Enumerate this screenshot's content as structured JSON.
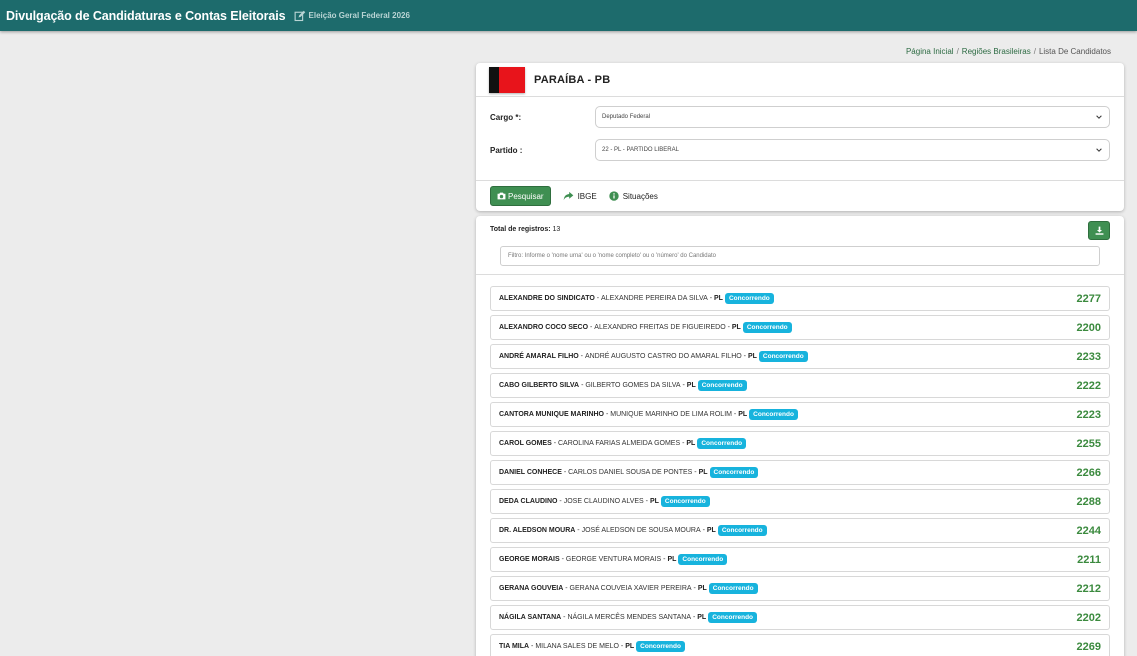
{
  "header": {
    "title": "Divulgação de Candidaturas e Contas Eleitorais",
    "election": "Eleição Geral Federal 2026"
  },
  "breadcrumb": {
    "home": "Página Inicial",
    "regions": "Regiões Brasileiras",
    "current": "Lista De Candidatos"
  },
  "state": {
    "name": "PARAÍBA - PB",
    "flag_text": "NEGO",
    "flag_colors": [
      "#111111",
      "#e8141b"
    ]
  },
  "form": {
    "cargo_label": "Cargo *:",
    "cargo_value": "Deputado Federal",
    "partido_label": "Partido :",
    "partido_value": "22 - PL - PARTIDO LIBERAL"
  },
  "actions": {
    "search": "Pesquisar",
    "ibge": "IBGE",
    "situacoes": "Situações"
  },
  "results": {
    "total_label": "Total de registros:",
    "total_value": "13",
    "filter_placeholder": "Filtro: Informe o 'nome urna' ou o 'nome completo' ou o 'número' do Candidato",
    "status_color": "#17b3dd",
    "number_color": "#3b8a3e",
    "candidates": [
      {
        "urn": "ALEXANDRE DO SINDICATO",
        "full": "ALEXANDRE PEREIRA DA SILVA",
        "party": "PL",
        "status": "Concorrendo",
        "number": "2277"
      },
      {
        "urn": "ALEXANDRO COCO SECO",
        "full": "ALEXANDRO FREITAS DE FIGUEIREDO",
        "party": "PL",
        "status": "Concorrendo",
        "number": "2200"
      },
      {
        "urn": "ANDRÉ AMARAL FILHO",
        "full": "ANDRÉ AUGUSTO CASTRO DO AMARAL FILHO",
        "party": "PL",
        "status": "Concorrendo",
        "number": "2233"
      },
      {
        "urn": "CABO GILBERTO SILVA",
        "full": "GILBERTO GOMES DA SILVA",
        "party": "PL",
        "status": "Concorrendo",
        "number": "2222"
      },
      {
        "urn": "CANTORA MUNIQUE MARINHO",
        "full": "MUNIQUE MARINHO DE LIMA ROLIM",
        "party": "PL",
        "status": "Concorrendo",
        "number": "2223"
      },
      {
        "urn": "CAROL GOMES",
        "full": "CAROLINA FARIAS ALMEIDA GOMES",
        "party": "PL",
        "status": "Concorrendo",
        "number": "2255"
      },
      {
        "urn": "DANIEL CONHECE",
        "full": "CARLOS DANIEL SOUSA DE PONTES",
        "party": "PL",
        "status": "Concorrendo",
        "number": "2266"
      },
      {
        "urn": "DEDA CLAUDINO",
        "full": "JOSE CLAUDINO ALVES",
        "party": "PL",
        "status": "Concorrendo",
        "number": "2288"
      },
      {
        "urn": "DR. ALEDSON MOURA",
        "full": "JOSÉ ALEDSON DE SOUSA MOURA",
        "party": "PL",
        "status": "Concorrendo",
        "number": "2244"
      },
      {
        "urn": "GEORGE MORAIS",
        "full": "GEORGE VENTURA MORAIS",
        "party": "PL",
        "status": "Concorrendo",
        "number": "2211"
      },
      {
        "urn": "GERANA GOUVEIA",
        "full": "GERANA COUVEIA XAVIER PEREIRA",
        "party": "PL",
        "status": "Concorrendo",
        "number": "2212"
      },
      {
        "urn": "NÁGILA SANTANA",
        "full": "NÁGILA MERCÊS MENDES SANTANA",
        "party": "PL",
        "status": "Concorrendo",
        "number": "2202"
      },
      {
        "urn": "TIA MILA",
        "full": "MILANA SALES DE MELO",
        "party": "PL",
        "status": "Concorrendo",
        "number": "2269"
      }
    ]
  }
}
